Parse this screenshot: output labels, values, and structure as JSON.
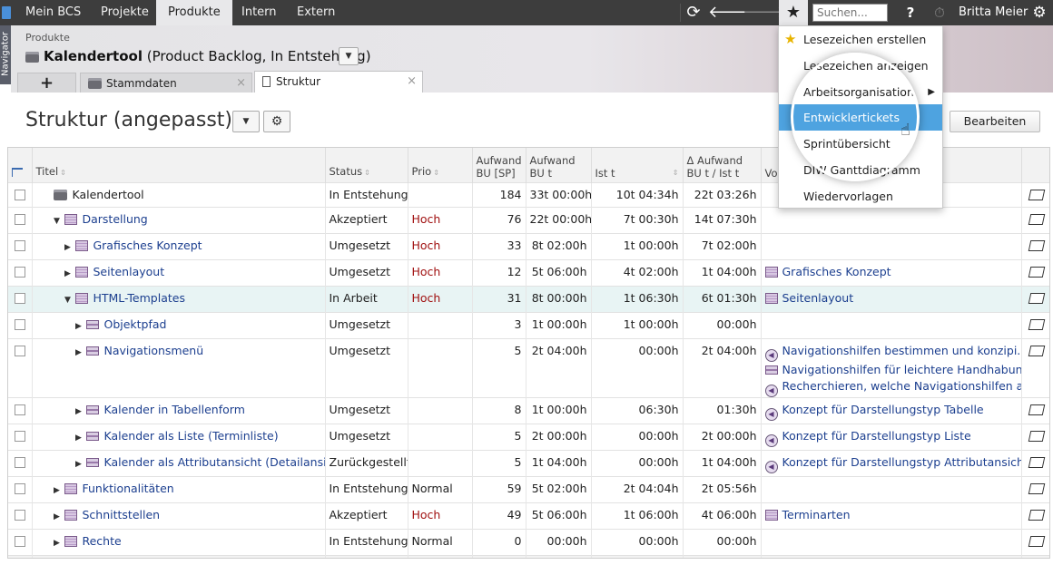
{
  "topbar": {
    "tabs": [
      "Mein BCS",
      "Projekte",
      "Produkte",
      "Intern",
      "Extern"
    ],
    "search_placeholder": "Suchen...",
    "help": "?",
    "user": "Britta Meier"
  },
  "sidebar": {
    "label": "Navigator"
  },
  "header": {
    "breadcrumb": "Produkte",
    "title_bold": "Kalendertool",
    "title_rest": "(Product Backlog, In Entstehung)",
    "tabs": [
      "Stammdaten",
      "Struktur"
    ]
  },
  "view": {
    "title": "Struktur (angepasst)",
    "edit_button": "Bearbeiten"
  },
  "menu": {
    "items": [
      "Lesezeichen erstellen",
      "Lesezeichen anzeigen",
      "Arbeitsorganisation",
      "Entwicklertickets",
      "Sprintübersicht",
      "DIW Ganttdiagramm",
      "Wiedervorlagen"
    ]
  },
  "table": {
    "headers": {
      "title": "Titel",
      "status": "Status",
      "prio": "Prio",
      "aufwand_sp_1": "Aufwand",
      "aufwand_sp_2": "BU [SP]",
      "aufwand_t_1": "Aufwand",
      "aufwand_t_2": "BU t",
      "ist": "Ist t",
      "delta_1": "Δ Aufwand",
      "delta_2": "BU t / Ist t",
      "vor": "Vo"
    },
    "rows": [
      {
        "title": "Kalendertool",
        "status": "In Entstehung",
        "prio": "",
        "sp": "184",
        "bu": "33t 00:00h",
        "ist": "10t 04:34h",
        "delta": "22t 03:26h",
        "vor": []
      },
      {
        "title": "Darstellung",
        "status": "Akzeptiert",
        "prio": "Hoch",
        "sp": "76",
        "bu": "22t 00:00h",
        "ist": "7t 00:30h",
        "delta": "14t 07:30h",
        "vor": []
      },
      {
        "title": "Grafisches Konzept",
        "status": "Umgesetzt",
        "prio": "Hoch",
        "sp": "33",
        "bu": "8t 02:00h",
        "ist": "1t 00:00h",
        "delta": "7t 02:00h",
        "vor": []
      },
      {
        "title": "Seitenlayout",
        "status": "Umgesetzt",
        "prio": "Hoch",
        "sp": "12",
        "bu": "5t 06:00h",
        "ist": "4t 02:00h",
        "delta": "1t 04:00h",
        "vor": [
          "Grafisches Konzept"
        ]
      },
      {
        "title": "HTML-Templates",
        "status": "In Arbeit",
        "prio": "Hoch",
        "sp": "31",
        "bu": "8t 00:00h",
        "ist": "1t 06:30h",
        "delta": "6t 01:30h",
        "vor": [
          "Seitenlayout"
        ]
      },
      {
        "title": "Objektpfad",
        "status": "Umgesetzt",
        "prio": "",
        "sp": "3",
        "bu": "1t 00:00h",
        "ist": "1t 00:00h",
        "delta": "00:00h",
        "vor": []
      },
      {
        "title": "Navigationsmenü",
        "status": "Umgesetzt",
        "prio": "",
        "sp": "5",
        "bu": "2t 04:00h",
        "ist": "00:00h",
        "delta": "2t 04:00h",
        "vor": [
          "Navigationshilfen bestimmen und konzipi...",
          "Navigationshilfen für leichtere Handhabung",
          "Recherchieren, welche Navigationshilfen a..."
        ]
      },
      {
        "title": "Kalender in Tabellenform",
        "status": "Umgesetzt",
        "prio": "",
        "sp": "8",
        "bu": "1t 00:00h",
        "ist": "06:30h",
        "delta": "01:30h",
        "vor": [
          "Konzept für Darstellungstyp Tabelle"
        ]
      },
      {
        "title": "Kalender als Liste (Terminliste)",
        "status": "Umgesetzt",
        "prio": "",
        "sp": "5",
        "bu": "2t 00:00h",
        "ist": "00:00h",
        "delta": "2t 00:00h",
        "vor": [
          "Konzept für Darstellungstyp Liste"
        ]
      },
      {
        "title": "Kalender als Attributansicht (Detailansicht...",
        "status": "Zurückgestellt",
        "prio": "",
        "sp": "5",
        "bu": "1t 04:00h",
        "ist": "00:00h",
        "delta": "1t 04:00h",
        "vor": [
          "Konzept für Darstellungstyp Attributansicht"
        ]
      },
      {
        "title": "Funktionalitäten",
        "status": "In Entstehung",
        "prio": "Normal",
        "sp": "59",
        "bu": "5t 02:00h",
        "ist": "2t 04:04h",
        "delta": "2t 05:56h",
        "vor": []
      },
      {
        "title": "Schnittstellen",
        "status": "Akzeptiert",
        "prio": "Hoch",
        "sp": "49",
        "bu": "5t 06:00h",
        "ist": "1t 06:00h",
        "delta": "4t 06:00h",
        "vor": [
          "Terminarten"
        ]
      },
      {
        "title": "Rechte",
        "status": "In Entstehung",
        "prio": "Normal",
        "sp": "0",
        "bu": "00:00h",
        "ist": "00:00h",
        "delta": "00:00h",
        "vor": []
      }
    ]
  }
}
